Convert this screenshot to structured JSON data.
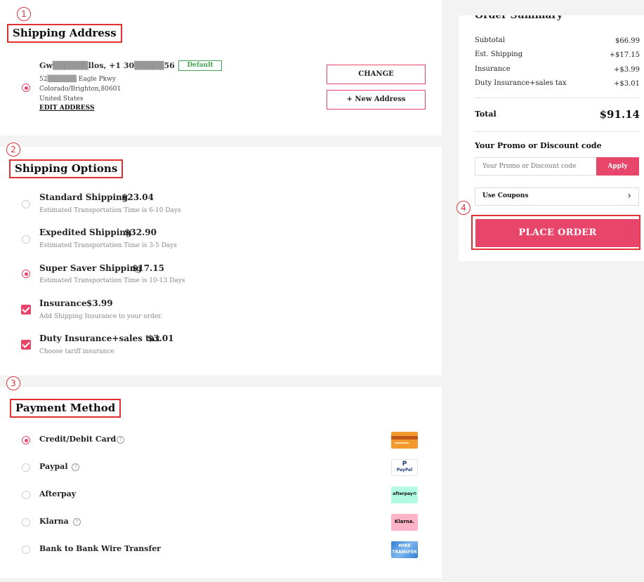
{
  "steps": [
    "1",
    "2",
    "3",
    "4"
  ],
  "shipping_address": {
    "title": "Shipping Address",
    "name_line": "Gw▒▒▒▒▒▒llos, +1 30▒▒▒▒▒56",
    "default_badge": "Default",
    "street": "52▒▒▒▒▒▒ Eagle Pkwy",
    "city_line": "Colorado/Brighton,80601",
    "country": "United States",
    "edit_label": "EDIT ADDRESS",
    "change_label": "CHANGE",
    "new_address_label": "+ New Address"
  },
  "shipping_options": {
    "title": "Shipping Options",
    "options": [
      {
        "name": "Standard Shipping",
        "price": "$23.04",
        "desc": "Estimated Transportation Time is 6-10 Days",
        "selected": false
      },
      {
        "name": "Expedited Shipping",
        "price": "$32.90",
        "desc": "Estimated Transportation Time is 3-5 Days",
        "selected": false
      },
      {
        "name": "Super Saver Shipping",
        "price": "$17.15",
        "desc": "Estimated Transportation Time is 10-13 Days",
        "selected": true
      }
    ],
    "addons": [
      {
        "name": "Insurance",
        "price": "$3.99",
        "desc": "Add Shipping Insurance to your order.",
        "checked": true
      },
      {
        "name": "Duty Insurance+sales tax",
        "price": "$3.01",
        "desc": "Choose tariff insurance",
        "checked": true
      }
    ]
  },
  "payment_method": {
    "title": "Payment Method",
    "methods": [
      {
        "label": "Credit/Debit Card",
        "selected": true,
        "help": "?"
      },
      {
        "label": "Paypal",
        "selected": false,
        "help": "?"
      },
      {
        "label": "Afterpay",
        "selected": false
      },
      {
        "label": "Klarna",
        "selected": false,
        "help": "?"
      },
      {
        "label": "Bank to Bank Wire Transfer",
        "selected": false
      }
    ],
    "logos": {
      "paypal_p": "P",
      "paypal": "PayPal",
      "afterpay": "afterpay⟲",
      "klarna": "Klarna.",
      "wire_1": "WIRE",
      "wire_2": "TRANSFER"
    }
  },
  "order_summary": {
    "title": "Order Summary",
    "rows": [
      {
        "label": "Subtotal",
        "value": "$66.99"
      },
      {
        "label": "Est. Shipping",
        "value": "+$17.15"
      },
      {
        "label": "Insurance",
        "value": "+$3.99"
      },
      {
        "label": "Duty Insurance+sales tax",
        "value": "+$3.01"
      }
    ],
    "total_label": "Total",
    "total_value": "$91.14",
    "promo_title": "Your Promo or Discount code",
    "promo_placeholder": "Your Promo or Discount code",
    "apply_label": "Apply",
    "coupons_label": "Use Coupons",
    "coupons_chevron": "›",
    "place_order_label": "PLACE ORDER"
  },
  "colors": {
    "accent": "#e8456a",
    "highlight_box": "#e0302f",
    "default_green": "#3fa34d"
  }
}
